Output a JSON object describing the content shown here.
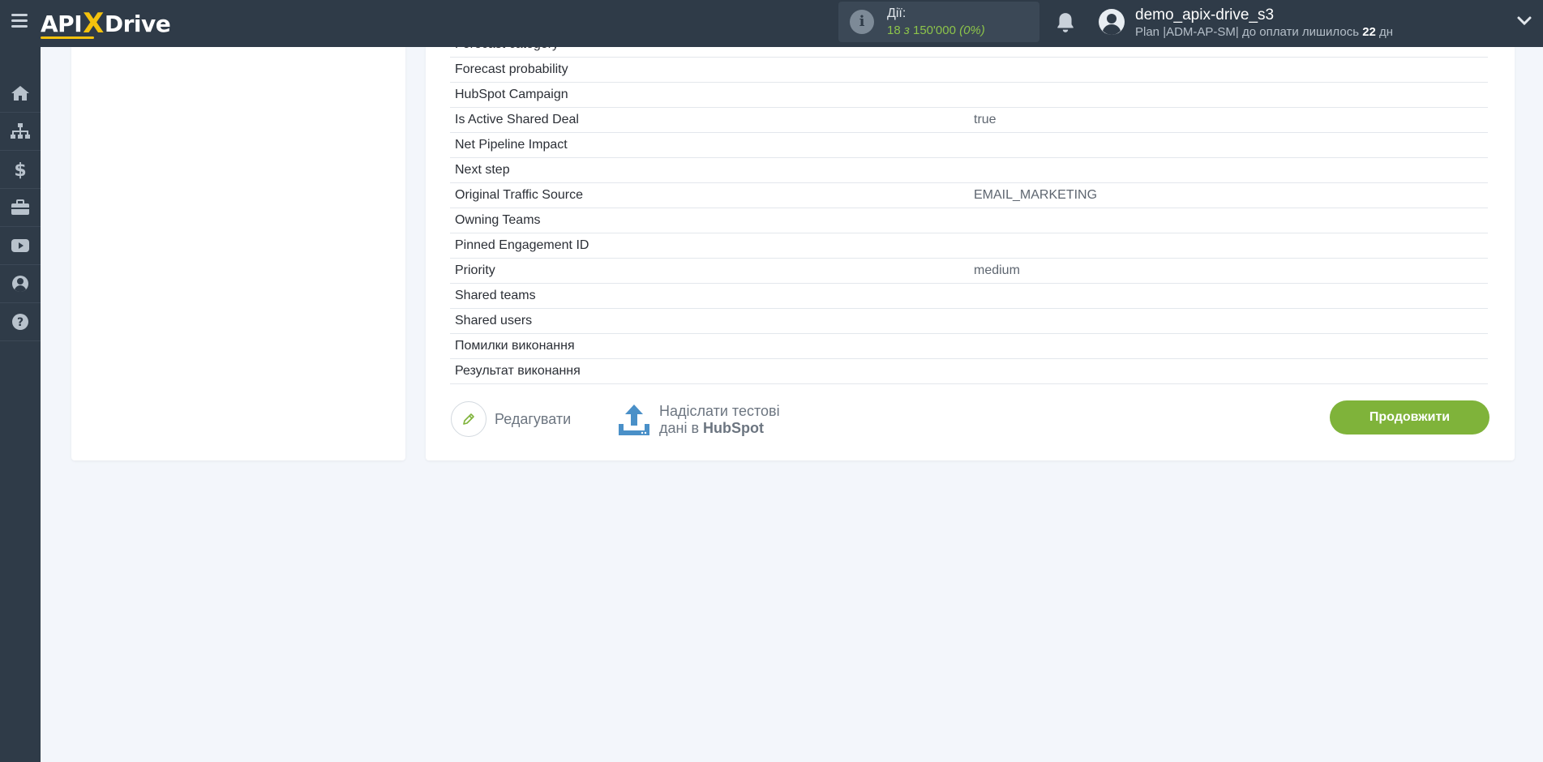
{
  "header": {
    "logo": {
      "left": "API",
      "x": "X",
      "right": "Drive"
    },
    "actions": {
      "label": "Дії:",
      "used": "18",
      "separator": " з ",
      "limit": "150'000",
      "percent": "(0%)"
    },
    "user": {
      "name": "demo_apix-drive_s3",
      "plan_prefix": "Plan |ADM-AP-SM| до оплати лишилось ",
      "days": "22",
      "days_unit": " дн"
    }
  },
  "sidebar": {
    "items": [
      {
        "name": "home-icon"
      },
      {
        "name": "sitemap-icon"
      },
      {
        "name": "dollar-icon"
      },
      {
        "name": "briefcase-icon"
      },
      {
        "name": "youtube-icon"
      },
      {
        "name": "user-icon"
      },
      {
        "name": "help-icon"
      }
    ]
  },
  "fields": [
    {
      "label": "Forecast category",
      "value": ""
    },
    {
      "label": "Forecast probability",
      "value": ""
    },
    {
      "label": "HubSpot Campaign",
      "value": ""
    },
    {
      "label": "Is Active Shared Deal",
      "value": "true"
    },
    {
      "label": "Net Pipeline Impact",
      "value": ""
    },
    {
      "label": "Next step",
      "value": ""
    },
    {
      "label": "Original Traffic Source",
      "value": "EMAIL_MARKETING"
    },
    {
      "label": "Owning Teams",
      "value": ""
    },
    {
      "label": "Pinned Engagement ID",
      "value": ""
    },
    {
      "label": "Priority",
      "value": "medium"
    },
    {
      "label": "Shared teams",
      "value": ""
    },
    {
      "label": "Shared users",
      "value": ""
    },
    {
      "label": "Помилки виконання",
      "value": ""
    },
    {
      "label": "Результат виконання",
      "value": ""
    }
  ],
  "buttons": {
    "edit": "Редагувати",
    "send_line1": "Надіслати тестові",
    "send_line2_prefix": "дані в ",
    "send_service": "HubSpot",
    "continue": "Продовжити"
  },
  "colors": {
    "topbar": "#2f3b48",
    "accent_green": "#7fb33a",
    "logo_yellow": "#f4c20d"
  }
}
